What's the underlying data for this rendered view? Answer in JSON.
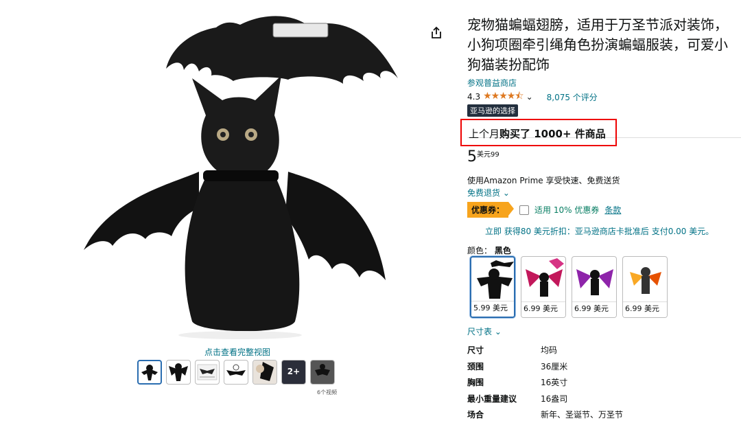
{
  "product": {
    "title": "宠物猫蝙蝠翅膀，适用于万圣节派对装饰，小狗项圈牵引绳角色扮演蝙蝠服装，可爱小狗猫装扮配饰",
    "store_link": "参观普益商店",
    "rating": "4.3",
    "stars": "★★★★⯪",
    "rating_count": "8,075 个评分",
    "badge": "亚马逊的选择",
    "bought_prefix": "上个月",
    "bought_bold": "购买了 1000+ 件商品",
    "price_whole": "5",
    "price_fraction": "美元99",
    "prime_text": "使用Amazon Prime 享受快速、免费送货",
    "returns": "免费退货",
    "coupon_tag": "优惠券：",
    "coupon_text": "适用 10% 优惠券",
    "coupon_terms": "条款",
    "card_offer": "立即 获得80 美元折扣：亚马逊商店卡批准后 支付0.00 美元。",
    "color_label": "颜色：",
    "color_value": "黑色",
    "swatch_prices": [
      "5.99 美元",
      "6.99 美元",
      "6.99 美元",
      "6.99 美元"
    ],
    "size_chart": "尺寸表"
  },
  "gallery": {
    "view_full": "点击查看完整视图",
    "more_label": "2+",
    "videos_label": "6个视频"
  },
  "specs": [
    {
      "k": "尺寸",
      "v": "均码"
    },
    {
      "k": "颈围",
      "v": "36厘米"
    },
    {
      "k": "胸围",
      "v": "16英寸"
    },
    {
      "k": "最小重量建议",
      "v": "16盎司"
    },
    {
      "k": "场合",
      "v": "新年、圣诞节、万圣节"
    }
  ],
  "colors": {
    "accent_link": "#007185",
    "coupon": "#f7a41d",
    "highlight_box": "#ee0000",
    "stars": "#de7921"
  }
}
